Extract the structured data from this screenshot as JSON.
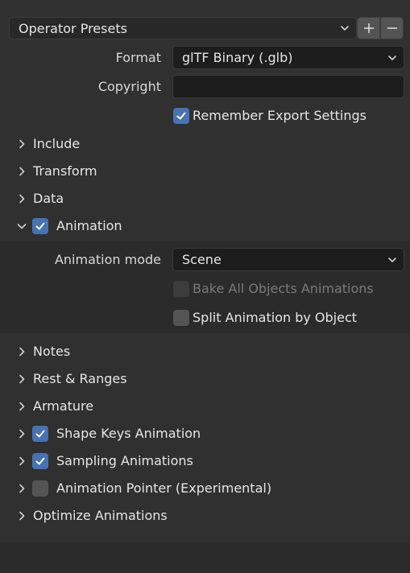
{
  "presets": {
    "label": "Operator Presets",
    "add_icon": "plus-icon",
    "remove_icon": "minus-icon"
  },
  "format": {
    "label": "Format",
    "value": "glTF Binary (.glb)"
  },
  "copyright": {
    "label": "Copyright",
    "value": ""
  },
  "remember": {
    "label": "Remember Export Settings",
    "checked": true
  },
  "sections": {
    "include": {
      "label": "Include"
    },
    "transform": {
      "label": "Transform"
    },
    "data": {
      "label": "Data"
    },
    "animation": {
      "label": "Animation",
      "checked": true,
      "expanded": true
    },
    "notes": {
      "label": "Notes"
    },
    "rest_ranges": {
      "label": "Rest & Ranges"
    },
    "armature": {
      "label": "Armature"
    },
    "shape_keys": {
      "label": "Shape Keys Animation",
      "checked": true
    },
    "sampling": {
      "label": "Sampling Animations",
      "checked": true
    },
    "pointer": {
      "label": "Animation Pointer (Experimental)",
      "checked": false
    },
    "optimize": {
      "label": "Optimize Animations"
    }
  },
  "animation": {
    "mode_label": "Animation mode",
    "mode_value": "Scene",
    "bake_label": "Bake All Objects Animations",
    "bake_checked": false,
    "split_label": "Split Animation by Object",
    "split_checked": false
  },
  "colors": {
    "accent": "#4772b3",
    "panel": "#303030",
    "field": "#1d1d1d"
  }
}
